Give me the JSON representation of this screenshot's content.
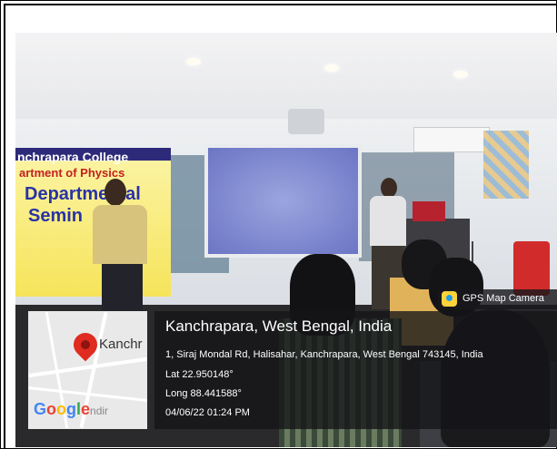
{
  "banner": {
    "line1": "nchrapara College",
    "line2": "artment of Physics",
    "line3": "Departmental",
    "line4": "Semin"
  },
  "gps_app": {
    "name": "GPS Map Camera",
    "icon": "gps-map-camera-icon"
  },
  "map": {
    "place_label": "Kanchr",
    "logo": "Google",
    "logo_suffix": "ndir",
    "pin_icon": "map-pin-icon",
    "pin_color": "#e02b20"
  },
  "location": {
    "title": "Kanchrapara, West Bengal, India",
    "address": "1, Siraj Mondal Rd, Halisahar, Kanchrapara, West Bengal 743145, India",
    "lat": "Lat 22.950148°",
    "long": "Long 88.441588°",
    "datetime": "04/06/22 01:24 PM"
  }
}
